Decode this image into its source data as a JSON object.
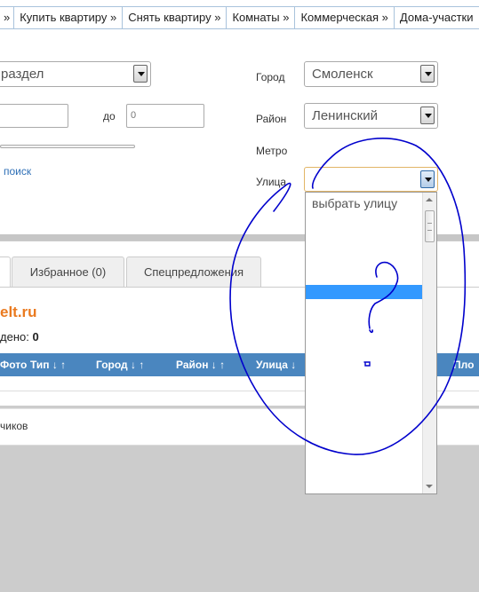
{
  "nav": {
    "items": [
      {
        "label": "»"
      },
      {
        "label": "Купить квартиру »"
      },
      {
        "label": "Снять квартиру »"
      },
      {
        "label": "Комнаты »"
      },
      {
        "label": "Коммерческая »"
      },
      {
        "label": "Дома-участки"
      }
    ]
  },
  "search": {
    "section_value": "раздел",
    "price_to_label": "до",
    "price_to_value": "0",
    "advanced_link": "поиск",
    "city_label": "Город",
    "city_value": "Смоленск",
    "district_label": "Район",
    "district_value": "Ленинский",
    "metro_label": "Метро",
    "street_label": "Улица",
    "street_placeholder": "выбрать улицу"
  },
  "tabs": [
    {
      "label": "Избранное (0)"
    },
    {
      "label": "Спецпредложения"
    }
  ],
  "results": {
    "site": "elt.ru",
    "found_label": "дено:",
    "found_count": "0",
    "columns": [
      "Фото",
      "Тип ↓ ↑",
      "Город ↓ ↑",
      "Район ↓ ↑",
      "Улица ↓",
      "Пло"
    ]
  },
  "footer": {
    "text": "чиков"
  },
  "annotation": {
    "question_mark": "?",
    "color": "#0000cc"
  },
  "colors": {
    "nav_border": "#a9c3dc",
    "table_header": "#4a86bf",
    "site_accent": "#ea7a1f",
    "link": "#2e6fb6",
    "selection": "#3399ff"
  }
}
